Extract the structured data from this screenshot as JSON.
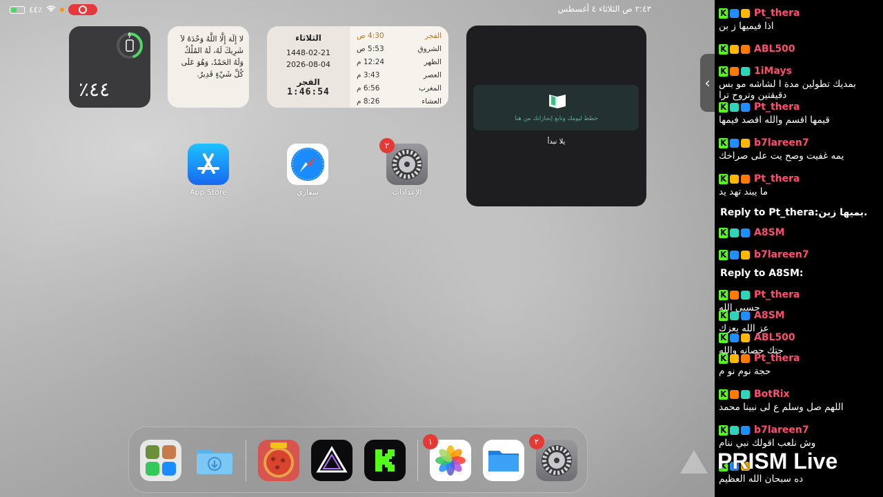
{
  "status": {
    "battery_text": "٤٤٪",
    "datetime": "٢:٤٣ ص   الثلاثاء ٤ أغسطس"
  },
  "battery_widget": {
    "percent_text": "٤٤٪",
    "level": 0.44
  },
  "dhikr_widget": {
    "text": "لا إِلَهَ إِلَّا اللَّهُ وَحْدَهُ لاَ شَرِيكَ لَهُ، لَهُ المُلْكُ وَلَهُ الحَمْدُ، وَهُوَ عَلَى كُلِّ شَيْءٍ قَدِيرٌ."
  },
  "prayer_widget": {
    "day": "الثلاثاء",
    "hijri": "1448-02-21",
    "gregorian": "2026-08-04",
    "next_prayer": "الفجر",
    "countdown": "1:46:54",
    "prayers": [
      {
        "name": "الفجر",
        "time": "4:30 ص",
        "active": true
      },
      {
        "name": "الشروق",
        "time": "5:53 ص",
        "active": false
      },
      {
        "name": "الظهر",
        "time": "12:24 م",
        "active": false
      },
      {
        "name": "العصر",
        "time": "3:43 م",
        "active": false
      },
      {
        "name": "المغرب",
        "time": "6:56 م",
        "active": false
      },
      {
        "name": "العشاء",
        "time": "8:26 م",
        "active": false
      }
    ]
  },
  "achievement_widget": {
    "hint": "خطط ليومك وتابع إنجازاتك من هنا",
    "go_button": "يلا نبدأ"
  },
  "apps": [
    {
      "label": "App Store"
    },
    {
      "label": "سفاري"
    },
    {
      "label": "الإعدادات",
      "badge": "٢"
    }
  ],
  "dock": {
    "photos_badge": "١",
    "settings_badge": "٢"
  },
  "chat": {
    "messages": [
      {
        "user": "Pt_thera",
        "text": "اذا فيميها ز بن",
        "color": "#ff4d6d"
      },
      {
        "user": "ABL500",
        "text": "",
        "color": "#ff4d6d"
      },
      {
        "user": "1iMays",
        "text": "بمديك تطولين مدة ا لشاشه مو بس دقيقتين وتروح ترا",
        "color": "#ff4d6d"
      },
      {
        "user": "Pt_thera",
        "text": "قيمها اقسم والله اقصد فيمها",
        "color": "#ff4d6d"
      },
      {
        "user": "b7lareen7",
        "text": "يمه غفيت وصح يت على صراخك",
        "color": "#ff4d6d"
      },
      {
        "user": "Pt_thera",
        "text": "ما يبند تهد يد",
        "color": "#ff4d6d"
      },
      {
        "reply": "Reply to Pt_thera:يميها زين."
      },
      {
        "user": "A8SM",
        "text": "",
        "color": "#ff4d6d"
      },
      {
        "user": "b7lareen7",
        "text": "",
        "color": "#ff4d6d"
      },
      {
        "reply": "Reply to A8SM:"
      },
      {
        "user": "Pt_thera",
        "text": "حسبي الله",
        "color": "#ff4d6d"
      },
      {
        "user": "A8SM",
        "text": "عز الله يعزك",
        "color": "#ff4d6d"
      },
      {
        "user": "ABL500",
        "text": "جتك حصانه والله",
        "color": "#ff4d6d"
      },
      {
        "user": "Pt_thera",
        "text": "حجة نوم نو م",
        "color": "#ff4d6d"
      },
      {
        "user": "BotRix",
        "text": "اللهم صل وسلم ع لى نبينا محمد",
        "color": "#ff4d6d"
      },
      {
        "user": "b7lareen7",
        "text": "وش نلعب اقولك نبي ننام",
        "color": "#ff4d6d"
      },
      {
        "user": "",
        "text": "ده سبحان الله العظيم",
        "color": "#ff4d6d"
      }
    ],
    "overlay": "PRISM Live"
  }
}
